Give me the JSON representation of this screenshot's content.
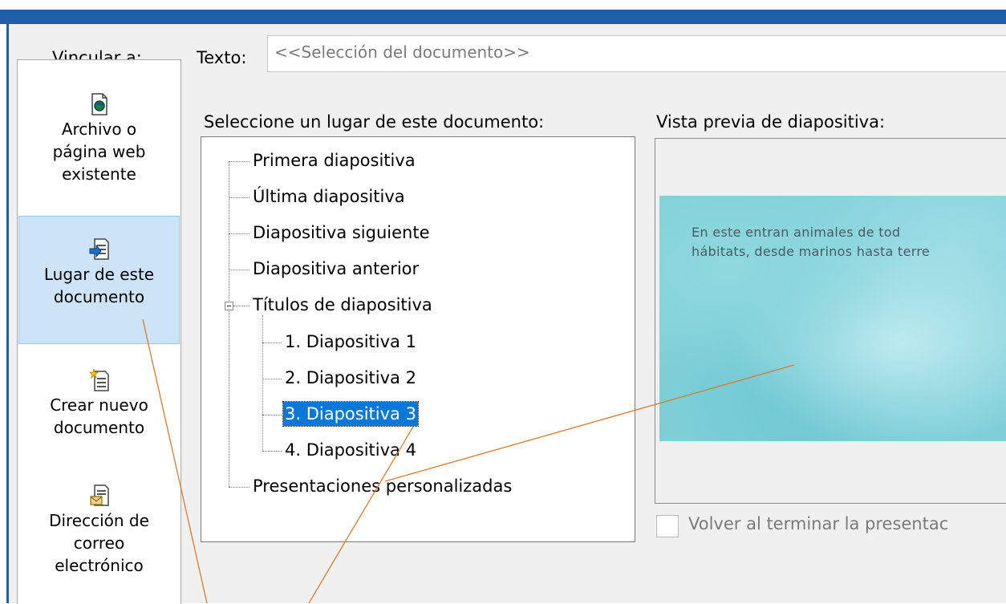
{
  "dialog": {
    "link_to_label": "Vincular a:",
    "text_label": "Texto:",
    "text_value": "<<Selección del documento>>"
  },
  "sidebar": {
    "items": [
      {
        "label": "Archivo o\npágina web\nexistente",
        "icon": "web-page-icon",
        "selected": false
      },
      {
        "label": "Lugar de este\ndocumento",
        "icon": "place-in-document-icon",
        "selected": true
      },
      {
        "label": "Crear nuevo\ndocumento",
        "icon": "new-document-icon",
        "selected": false
      },
      {
        "label": "Dirección de\ncorreo\nelectrónico",
        "icon": "email-address-icon",
        "selected": false
      }
    ]
  },
  "tree": {
    "heading": "Seleccione un lugar de este documento:",
    "nodes": [
      "Primera diapositiva",
      "Última diapositiva",
      "Diapositiva siguiente",
      "Diapositiva anterior",
      "Títulos de diapositiva",
      "1. Diapositiva 1",
      "2. Diapositiva 2",
      "3. Diapositiva 3",
      "4. Diapositiva 4",
      "Presentaciones personalizadas"
    ],
    "selected": "3. Diapositiva 3"
  },
  "preview": {
    "heading": "Vista previa de diapositiva:",
    "slide_text": "En este entran animales de tod\nhábitats, desde marinos hasta terre"
  },
  "return_checkbox": {
    "label": "Volver al terminar la presentac",
    "checked": false
  },
  "colors": {
    "title_bar": "#1f5fa8",
    "selection": "#0b78d7",
    "sidebar_selected": "#cde3f7",
    "annotation_line": "#e07a2a"
  }
}
